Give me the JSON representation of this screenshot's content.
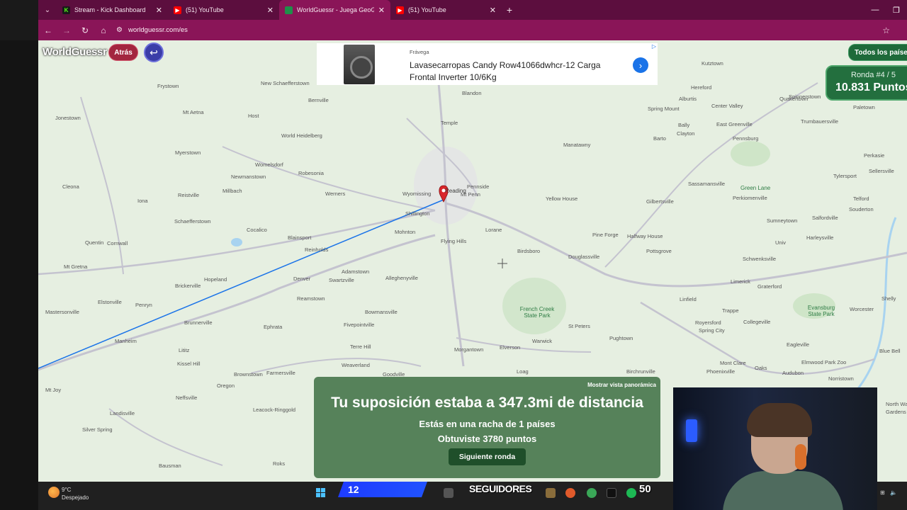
{
  "browser": {
    "tabs": [
      {
        "title": "Stream - Kick Dashboard",
        "icon": "kick-icon",
        "active": false
      },
      {
        "title": "(51) YouTube",
        "icon": "youtube-icon",
        "active": false
      },
      {
        "title": "WorldGuessr - Juega GeoGuessr",
        "icon": "worldguessr-icon",
        "active": true
      },
      {
        "title": "(51) YouTube",
        "icon": "youtube-icon",
        "active": false
      }
    ],
    "url": "worldguessr.com/es"
  },
  "game": {
    "logo": "WorldGuessr",
    "back_label": "Atrás",
    "all_countries_label": "Todos los países",
    "round_label": "Ronda #4 / 5",
    "points_total": "10.831 Puntos",
    "result": {
      "panorama_label": "Mostrar vista panorámica",
      "headline": "Tu suposición estaba a 347.3mi de distancia",
      "streak": "Estás en una racha de 1 países",
      "points": "Obtuviste 3780 puntos",
      "next_label": "Siguiente ronda"
    }
  },
  "ad": {
    "brand": "Frávega",
    "title": "Lavasecarropas Candy Row41066dwhcr-12 Carga Frontal Inverter 10/6Kg"
  },
  "map": {
    "places": [
      "Frystown",
      "New Schaefferstown",
      "Bernville",
      "Blandon",
      "Jonestown",
      "Mt Aetna",
      "Host",
      "World Heidelberg",
      "Temple",
      "Myerstown",
      "Womelsdorf",
      "Robesonia",
      "Werners",
      "Reading",
      "Pennside",
      "Mt Penn",
      "Newmanstown",
      "Millbach",
      "Wyomissing",
      "Shillington",
      "Cleona",
      "Reistville",
      "Iona",
      "Schaefferstown",
      "Cocalico",
      "Mohnton",
      "Lorane",
      "Yellow House",
      "Manatawny",
      "Gilbertsville",
      "Sassamansville",
      "Green Lane",
      "Perkiomenville",
      "Quentin",
      "Cornwall",
      "Blainsport",
      "Reinholds",
      "Flying Hills",
      "Birdsboro",
      "Douglassville",
      "Pine Forge",
      "Halfway House",
      "Pottsgrove",
      "Schwenksville",
      "Mt Gretna",
      "Denver",
      "Adamstown",
      "Swartzville",
      "Alleghenyville",
      "Hopeland",
      "Brickerville",
      "Lititz",
      "Penryn",
      "Elstonville",
      "Mastersonville",
      "Manheim",
      "Brunnerville",
      "Ephrata",
      "Reamstown",
      "Bowmansville",
      "Fivepointville",
      "Terre Hill",
      "Morgantown",
      "Elverson",
      "French Creek State Park",
      "St Peters",
      "Warwick",
      "Pughtown",
      "Linfield",
      "Limerick",
      "Royersford",
      "Spring City",
      "Collegeville",
      "Trappe",
      "Graterford",
      "Evansburg State Park",
      "Worcester",
      "Eagleville",
      "Kissel Hill",
      "Weaverland",
      "Goodville",
      "Loag",
      "Birchrunville",
      "Mont Clare",
      "Oaks",
      "Audubon",
      "Elmwood Park Zoo",
      "Norristown",
      "Blue Bell",
      "Phoenixville",
      "Brownstown",
      "Farmersville",
      "Oregon",
      "Neffsville",
      "Leacock-Ringgold",
      "Bausman",
      "Roks",
      "Silver Spring",
      "Mt Joy",
      "Landisville",
      "Kutztown",
      "Barto",
      "Bally",
      "Pennsburg",
      "Telford",
      "Souderton",
      "Harleysville",
      "Perkasie",
      "Tylersport",
      "Sellersville",
      "Paletown",
      "East Greenville",
      "Quakertown",
      "Spinnerstown",
      "Trumbauersville",
      "Clayton",
      "Hereford",
      "Sumneytown",
      "Salfordville",
      "Shelly",
      "North Wales",
      "Gardens",
      "Univ",
      "Spring Mount",
      "Center Valley",
      "Alburtis",
      "Macungie"
    ],
    "guess_line_color": "#1a73e8",
    "pin_color": "#d9262b"
  },
  "taskbar": {
    "temperature": "9°C",
    "condition": "Despejado",
    "overlay_number": "12",
    "overlay_followers": "SEGUIDORES",
    "overlay_count": "50"
  }
}
